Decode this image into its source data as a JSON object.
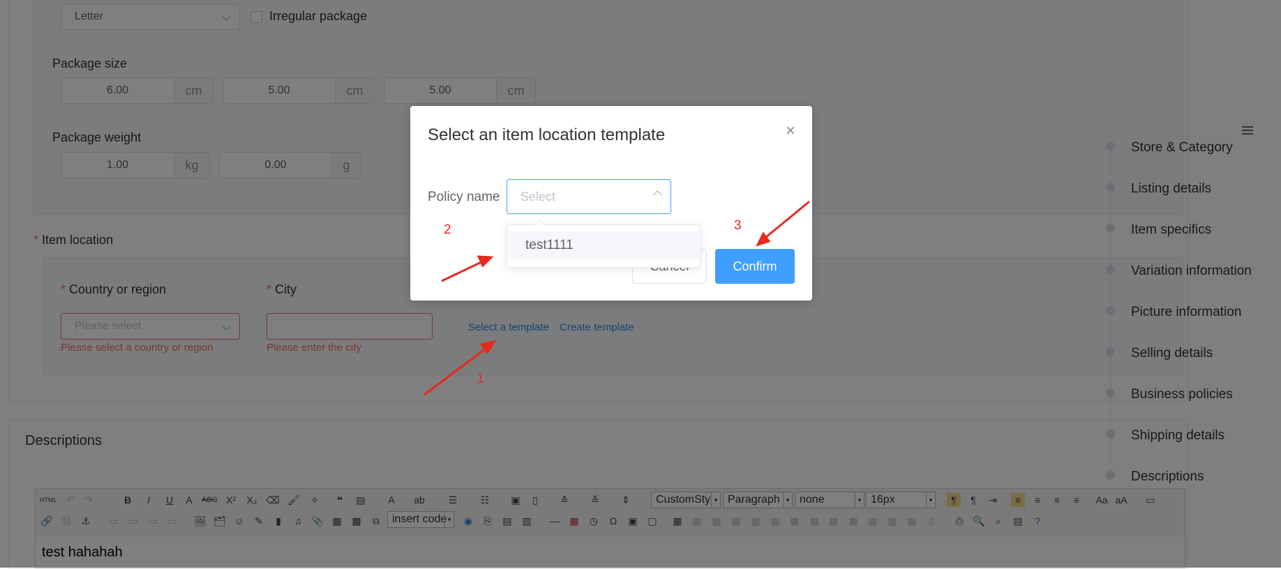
{
  "package": {
    "type_select": "Letter",
    "irregular_label": "Irregular package",
    "size_label": "Package size",
    "size_values": [
      "6.00",
      "5.00",
      "5.00"
    ],
    "size_unit": "cm",
    "weight_label": "Package weight",
    "weight_kg": "1.00",
    "weight_kg_unit": "kg",
    "weight_g": "0.00",
    "weight_g_unit": "g"
  },
  "item_location": {
    "title": "Item location",
    "required_mark": "*",
    "country_label": "Country or region",
    "country_placeholder": "Please select",
    "country_error": "Please select a country or region",
    "city_label": "City",
    "city_error": "Please enter the city",
    "select_template_link": "Select a template",
    "create_template_link": "Create template"
  },
  "descriptions": {
    "title": "Descriptions",
    "editor_text": "test hahahah",
    "toolbar": {
      "custom_style": "CustomSty",
      "paragraph": "Paragraph",
      "font_family": "none",
      "font_size": "16px",
      "insert_code": "insert code"
    }
  },
  "steps": [
    "Store & Category",
    "Listing details",
    "Item specifics",
    "Variation information",
    "Picture information",
    "Selling details",
    "Business policies",
    "Shipping details",
    "Descriptions"
  ],
  "modal": {
    "title": "Select an item location template",
    "policy_label": "Policy name",
    "policy_placeholder": "Select",
    "options": [
      "test1111"
    ],
    "cancel": "Cancel",
    "confirm": "Confirm",
    "close_symbol": "×"
  },
  "annotations": [
    "1",
    "2",
    "3"
  ],
  "colors": {
    "primary": "#409eff",
    "error": "#f56c6c",
    "annotation": "#e8291c"
  }
}
